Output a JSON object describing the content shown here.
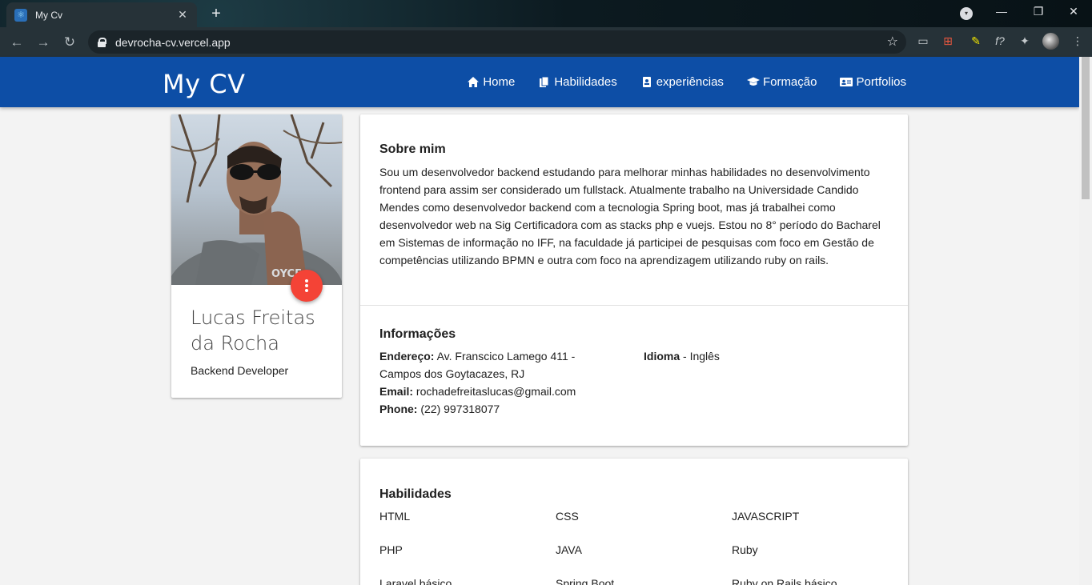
{
  "browser": {
    "tab_title": "My Cv",
    "url": "devrocha-cv.vercel.app",
    "colors": {
      "chrome_bg": "#263238",
      "omnibox_bg": "#1b2429"
    }
  },
  "site": {
    "brand": "My CV",
    "colors": {
      "header_bg": "#0d4ea6",
      "fab": "#f44336",
      "page_bg": "#f3f3f3"
    },
    "nav": [
      {
        "label": "Home",
        "icon": "home-icon"
      },
      {
        "label": "Habilidades",
        "icon": "copy-icon"
      },
      {
        "label": "experiências",
        "icon": "id-badge-icon"
      },
      {
        "label": "Formação",
        "icon": "graduation-cap-icon"
      },
      {
        "label": "Portfolios",
        "icon": "id-card-icon"
      }
    ]
  },
  "profile": {
    "name": "Lucas Freitas da Rocha",
    "role": "Backend Developer"
  },
  "about": {
    "title": "Sobre mim",
    "text": "Sou um desenvolvedor backend estudando para melhorar minhas habilidades no desenvolvimento frontend para assim ser considerado um fullstack. Atualmente trabalho na Universidade Candido Mendes como desenvolvedor backend com a tecnologia Spring boot, mas já trabalhei como desenvolvedor web na Sig Certificadora com as stacks php e vuejs. Estou no 8° período do Bacharel em Sistemas de informação no IFF, na faculdade já participei de pesquisas com foco em Gestão de competências utilizando BPMN e outra com foco na aprendizagem utilizando ruby on rails."
  },
  "info": {
    "title": "Informações",
    "address_label": "Endereço:",
    "address_value": "Av. Franscico Lamego 411 - Campos dos Goytacazes, RJ",
    "email_label": "Email:",
    "email_value": "rochadefreitaslucas@gmail.com",
    "phone_label": "Phone:",
    "phone_value": "(22) 997318077",
    "language_label": "Idioma",
    "language_value": "- Inglês"
  },
  "skills": {
    "title": "Habilidades",
    "items": [
      "HTML",
      "CSS",
      "JAVASCRIPT",
      "PHP",
      "JAVA",
      "Ruby",
      "Laravel básico",
      "Spring Boot",
      "Ruby on Rails básico"
    ]
  }
}
